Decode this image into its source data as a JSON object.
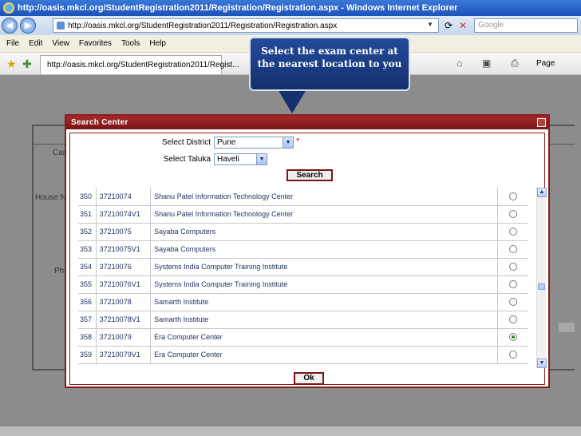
{
  "window": {
    "title": "http://oasis.mkcl.org/StudentRegistration2011/Registration/Registration.aspx - Windows Internet Explorer"
  },
  "address_bar": {
    "url": "http://oasis.mkcl.org/StudentRegistration2011/Registration/Registration.aspx",
    "search_placeholder": "Google"
  },
  "menu": {
    "items": [
      "File",
      "Edit",
      "View",
      "Favorites",
      "Tools",
      "Help"
    ]
  },
  "tab": {
    "label": "http://oasis.mkcl.org/StudentRegistration2011/Regist...",
    "page_menu": "Page"
  },
  "background_form": {
    "labels": [
      "Can",
      "House N",
      "Pho"
    ]
  },
  "dialog": {
    "title": "Search Center",
    "district_label": "Select District",
    "district_value": "Pune",
    "taluka_label": "Select Taluka",
    "taluka_value": "Haveli",
    "search_button": "Search",
    "ok_button": "Ok",
    "rows": [
      {
        "num": "350",
        "code": "37210074",
        "name": "Shanu Patel Information Technology Center",
        "selected": false
      },
      {
        "num": "351",
        "code": "37210074V1",
        "name": "Shanu Patel Information Technology Center",
        "selected": false
      },
      {
        "num": "352",
        "code": "37210075",
        "name": "Sayaba Computers",
        "selected": false
      },
      {
        "num": "353",
        "code": "37210075V1",
        "name": "Sayaba Computers",
        "selected": false
      },
      {
        "num": "354",
        "code": "37210076",
        "name": "Systems India Computer Training Institute",
        "selected": false
      },
      {
        "num": "355",
        "code": "37210076V1",
        "name": "Systems India Computer Training Institute",
        "selected": false
      },
      {
        "num": "356",
        "code": "37210078",
        "name": "Samarth Institute",
        "selected": false
      },
      {
        "num": "357",
        "code": "37210078V1",
        "name": "Samarth Institute",
        "selected": false
      },
      {
        "num": "358",
        "code": "37210079",
        "name": "Era Computer Center",
        "selected": true
      },
      {
        "num": "359",
        "code": "37210079V1",
        "name": "Era Computer Center",
        "selected": false
      }
    ]
  },
  "callout": {
    "text": "Select the exam center at the nearest location to you"
  },
  "colors": {
    "dialog_border": "#8a1c1c",
    "callout_bg": "#15306e",
    "row_text": "#1f2f5f"
  }
}
